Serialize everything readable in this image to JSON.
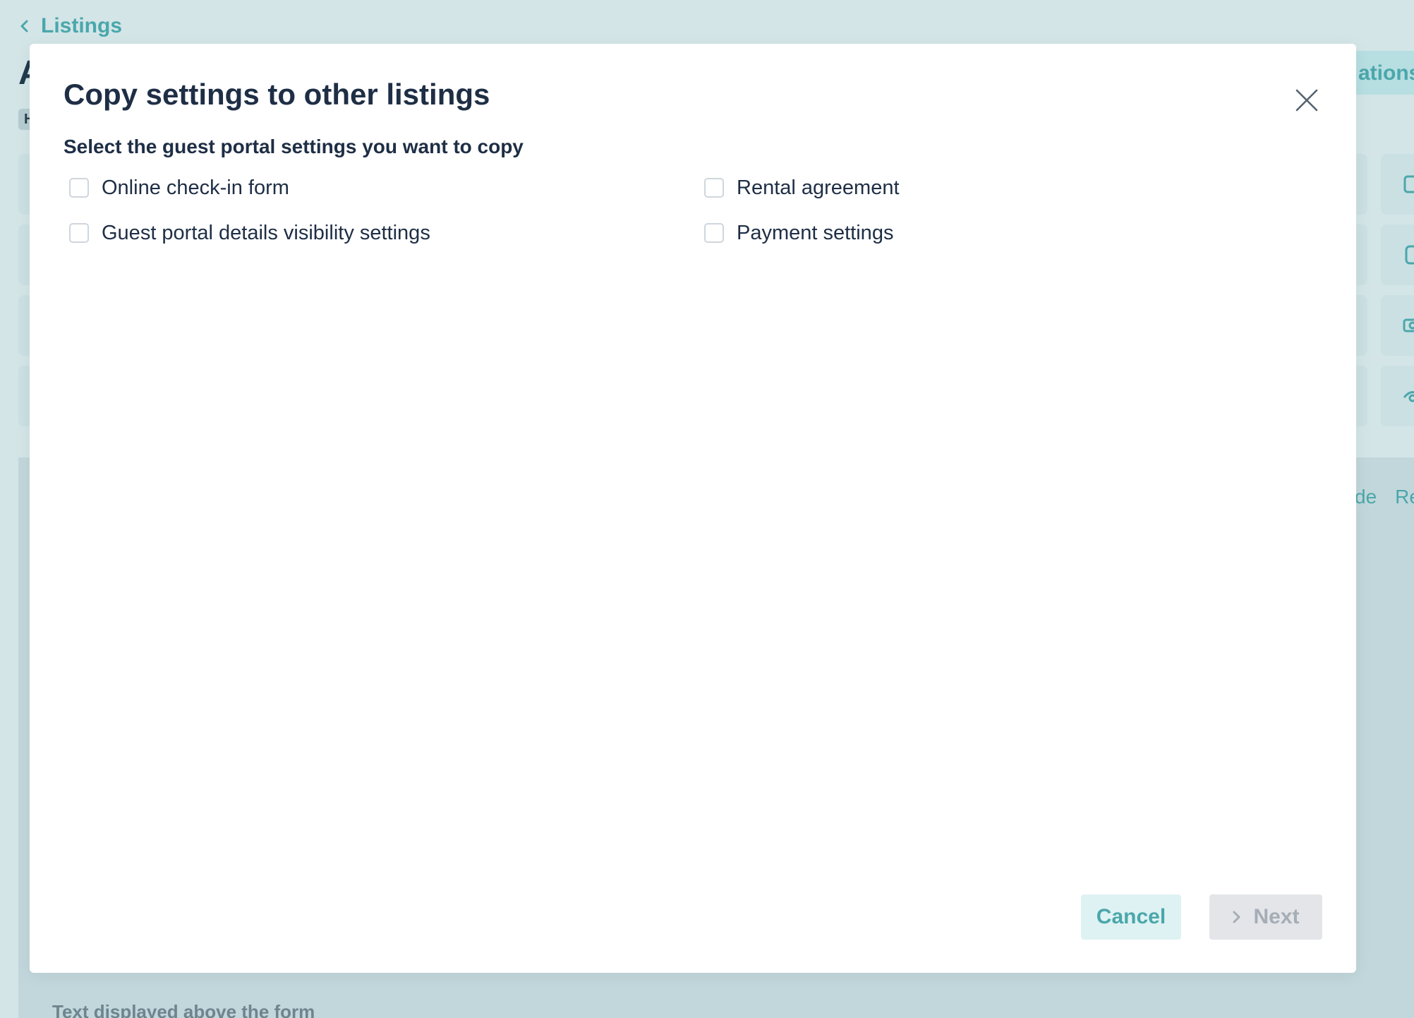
{
  "background": {
    "back_link": "Listings",
    "page_title_fragment": "A",
    "pill_fragment": "H",
    "integrations_fragment": "ations",
    "links": [
      "de",
      "Re"
    ],
    "form_label": "Text displayed above the form"
  },
  "modal": {
    "title": "Copy settings to other listings",
    "subtitle": "Select the guest portal settings you want to copy",
    "options": [
      {
        "label": "Online check-in form",
        "checked": false
      },
      {
        "label": "Rental agreement",
        "checked": false
      },
      {
        "label": "Guest portal details visibility settings",
        "checked": false
      },
      {
        "label": "Payment settings",
        "checked": false
      }
    ],
    "cancel_label": "Cancel",
    "next_label": "Next"
  },
  "colors": {
    "accent": "#4aa7ab",
    "heading": "#1e2e45",
    "overlay_bg": "#d3e5e7"
  }
}
